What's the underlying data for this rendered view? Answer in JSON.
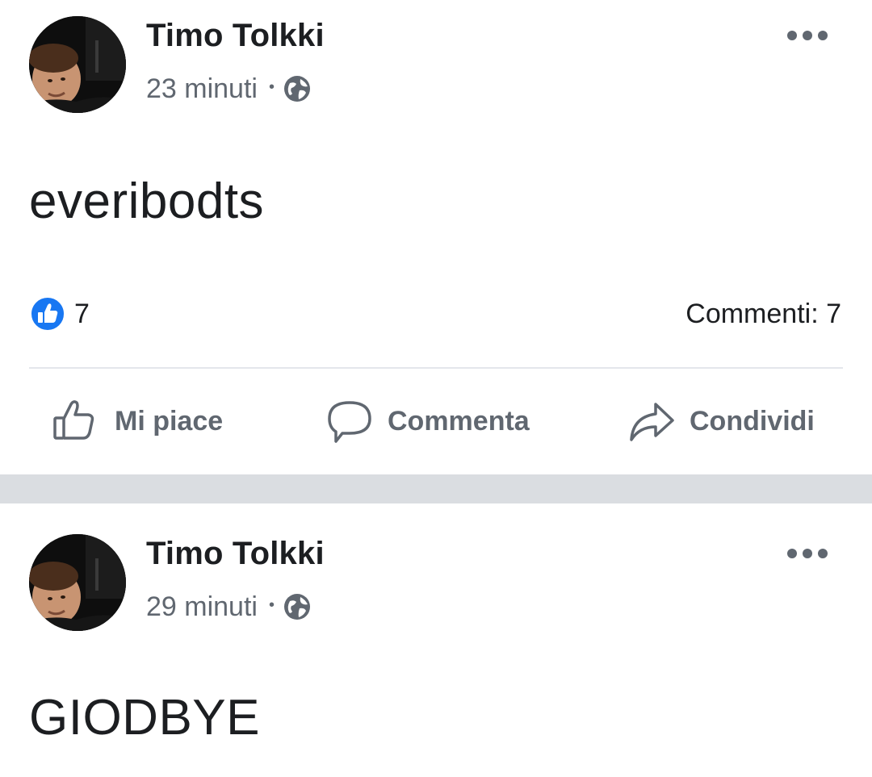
{
  "posts": [
    {
      "author": "Timo Tolkki",
      "time": "23 minuti",
      "separator": "•",
      "audience_icon": "globe-icon",
      "text": "everibodts",
      "reactions": {
        "icon": "like-reaction-icon",
        "count": "7"
      },
      "comments": "Commenti: 7",
      "actions": {
        "like": "Mi piace",
        "comment": "Commenta",
        "share": "Condividi"
      }
    },
    {
      "author": "Timo Tolkki",
      "time": "29 minuti",
      "separator": "•",
      "audience_icon": "globe-icon",
      "text": "GIODBYE"
    }
  ],
  "colors": {
    "primary_text": "#1c1e21",
    "secondary_text": "#606770",
    "like_blue": "#1877f2",
    "separator": "#dadde1",
    "divider": "#e4e6eb"
  }
}
